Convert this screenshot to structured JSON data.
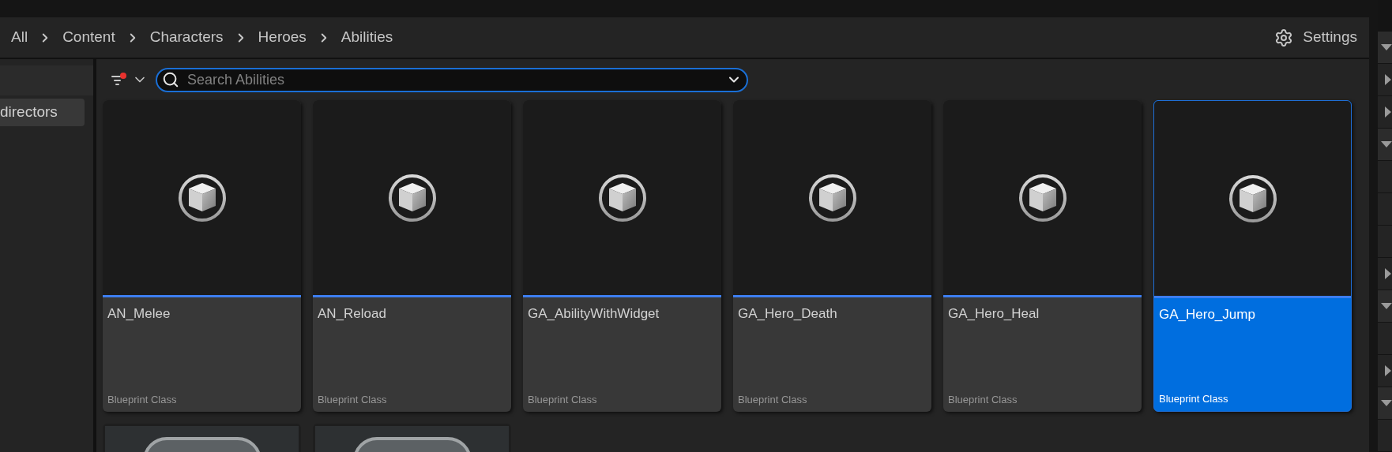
{
  "breadcrumb": [
    {
      "label": "All"
    },
    {
      "label": "Content"
    },
    {
      "label": "Characters"
    },
    {
      "label": "Heroes"
    },
    {
      "label": "Abilities"
    }
  ],
  "settings": {
    "label": "Settings"
  },
  "sidebar": {
    "items": [
      {
        "label": "directors",
        "selected": true
      }
    ]
  },
  "filter": {
    "active": true
  },
  "search": {
    "placeholder": "Search Abilities"
  },
  "assets": [
    {
      "name": "AN_Melee",
      "type": "Blueprint Class",
      "selected": false
    },
    {
      "name": "AN_Reload",
      "type": "Blueprint Class",
      "selected": false
    },
    {
      "name": "GA_AbilityWithWidget",
      "type": "Blueprint Class",
      "selected": false
    },
    {
      "name": "GA_Hero_Death",
      "type": "Blueprint Class",
      "selected": false
    },
    {
      "name": "GA_Hero_Heal",
      "type": "Blueprint Class",
      "selected": false
    },
    {
      "name": "GA_Hero_Jump",
      "type": "Blueprint Class",
      "selected": true
    }
  ],
  "partial_assets": [
    {
      "kind": "thumbnail"
    },
    {
      "kind": "thumbnail"
    }
  ],
  "side_strip": {
    "rows": [
      {
        "kind": "expander",
        "expanded": true
      },
      {
        "kind": "expander",
        "expanded": false
      },
      {
        "kind": "expander",
        "expanded": false
      },
      {
        "kind": "expander",
        "expanded": true
      },
      {
        "kind": "blank"
      },
      {
        "kind": "blank"
      },
      {
        "kind": "blank"
      },
      {
        "kind": "expander",
        "expanded": false
      },
      {
        "kind": "expander",
        "expanded": true
      },
      {
        "kind": "blank"
      },
      {
        "kind": "expander",
        "expanded": false
      },
      {
        "kind": "expander",
        "expanded": true
      },
      {
        "kind": "blank"
      }
    ]
  }
}
